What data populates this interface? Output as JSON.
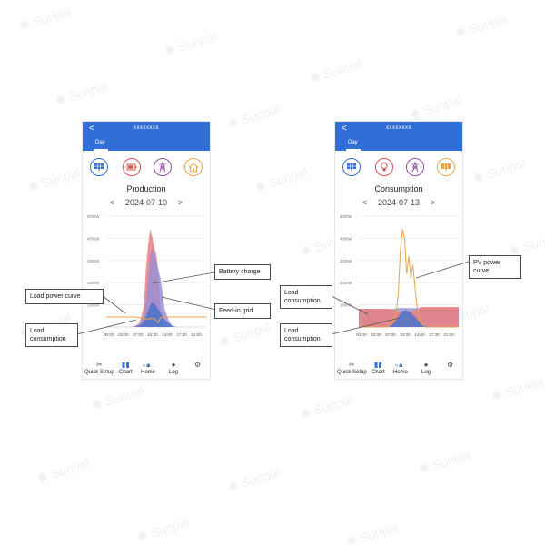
{
  "watermark": "Sunpal",
  "phones": {
    "left": {
      "header_title": "xxxxxxxx",
      "back_glyph": "<",
      "tabs": [
        "Day",
        "",
        ""
      ],
      "page_title": "Production",
      "date": "2024-07-10",
      "prev_glyph": "<",
      "next_glyph": ">",
      "icons": [
        "solar-panel-icon",
        "battery-icon",
        "grid-tower-icon",
        "home-icon"
      ],
      "nav": [
        "Quick Setup",
        "Chart",
        "Home",
        "Log",
        ""
      ],
      "chart_data": {
        "type": "area",
        "y_ticks": [
          "5000W",
          "4000W",
          "3000W",
          "2000W",
          "1000W"
        ],
        "x_ticks": [
          "00:00",
          "03:30",
          "07:00",
          "10:30",
          "14:00",
          "17:30",
          "21:00"
        ],
        "xlim": [
          0,
          24
        ],
        "ylim": [
          0,
          5000
        ],
        "x": [
          0,
          1,
          2,
          3,
          4,
          5,
          6,
          7,
          8,
          9,
          9.5,
          10,
          10.5,
          11,
          11.5,
          12,
          12.5,
          13,
          13.5,
          14,
          15,
          16,
          17,
          18,
          19,
          20,
          21,
          22,
          23,
          24
        ],
        "series": [
          {
            "name": "Battery charge",
            "color": "#e8807f",
            "values": [
              0,
              0,
              0,
              0,
              0,
              0,
              0,
              60,
              200,
              900,
              2600,
              3600,
              4400,
              4100,
              3600,
              3300,
              2400,
              900,
              200,
              100,
              0,
              0,
              0,
              0,
              0,
              0,
              0,
              0,
              0,
              0
            ]
          },
          {
            "name": "Feed-in grid",
            "color": "#9b8fd4",
            "values": [
              0,
              0,
              0,
              0,
              0,
              0,
              0,
              40,
              150,
              500,
              1200,
              2200,
              3200,
              3600,
              3400,
              3000,
              2600,
              2200,
              1600,
              800,
              300,
              0,
              0,
              0,
              0,
              0,
              0,
              0,
              0,
              0
            ]
          },
          {
            "name": "Load consumption",
            "color": "#4a73cc",
            "values": [
              0,
              0,
              0,
              0,
              0,
              0,
              0,
              0,
              60,
              250,
              450,
              700,
              950,
              1100,
              1050,
              950,
              800,
              650,
              500,
              350,
              150,
              40,
              0,
              0,
              0,
              0,
              0,
              0,
              0,
              0
            ]
          },
          {
            "name": "Load power curve",
            "color": "#e8a54b",
            "values": [
              450,
              450,
              450,
              450,
              450,
              450,
              450,
              450,
              420,
              380,
              360,
              380,
              360,
              400,
              380,
              300,
              200,
              420,
              430,
              450,
              450,
              450,
              450,
              450,
              450,
              450,
              450,
              450,
              450,
              450
            ]
          }
        ]
      },
      "callouts": [
        "Load power curve",
        "Load consumption",
        "Battery charge",
        "Feed-in grid"
      ]
    },
    "right": {
      "header_title": "xxxxxxxx",
      "back_glyph": "<",
      "tabs": [
        "Day",
        "",
        ""
      ],
      "page_title": "Consumption",
      "date": "2024-07-13",
      "prev_glyph": "<",
      "next_glyph": ">",
      "icons": [
        "solar-panel-icon",
        "bulb-icon",
        "grid-tower-icon",
        "battery-icon"
      ],
      "nav": [
        "Quick Setup",
        "Chart",
        "Home",
        "Log",
        ""
      ],
      "chart_data": {
        "type": "area",
        "y_ticks": [
          "5000W",
          "4000W",
          "3000W",
          "2000W",
          "1000W"
        ],
        "x_ticks": [
          "00:00",
          "03:30",
          "07:00",
          "10:30",
          "14:00",
          "17:30",
          "21:00"
        ],
        "xlim": [
          0,
          24
        ],
        "ylim": [
          0,
          5000
        ],
        "x": [
          0,
          1,
          2,
          3,
          4,
          5,
          6,
          7,
          8,
          9,
          9.5,
          10,
          10.5,
          11,
          11.5,
          12,
          12.5,
          13,
          13.5,
          14,
          15,
          16,
          17,
          18,
          19,
          20,
          21,
          22,
          23,
          24
        ],
        "series": [
          {
            "name": "Load consumption",
            "color": "#9b8fd4",
            "values": [
              800,
              800,
              800,
              800,
              800,
              800,
              800,
              800,
              800,
              850,
              850,
              850,
              850,
              850,
              850,
              850,
              850,
              850,
              850,
              850,
              850,
              850,
              850,
              850,
              850,
              850,
              850,
              850,
              850,
              850
            ]
          },
          {
            "name": "Load consumption",
            "color": "#e8807f",
            "values": [
              820,
              820,
              820,
              820,
              820,
              820,
              820,
              820,
              800,
              750,
              700,
              650,
              700,
              700,
              700,
              700,
              700,
              700,
              750,
              800,
              900,
              900,
              900,
              900,
              900,
              900,
              900,
              900,
              900,
              900
            ]
          },
          {
            "name": "Load consumption",
            "color": "#4a73cc",
            "values": [
              0,
              0,
              0,
              0,
              0,
              0,
              0,
              0,
              100,
              300,
              450,
              600,
              700,
              750,
              750,
              700,
              650,
              550,
              450,
              350,
              150,
              50,
              0,
              0,
              0,
              0,
              0,
              0,
              0,
              0
            ]
          },
          {
            "name": "PV power curve",
            "color": "#e8a54b",
            "values": [
              0,
              0,
              0,
              0,
              0,
              0,
              0,
              0,
              200,
              700,
              1500,
              3500,
              4400,
              4000,
              2400,
              3200,
              2200,
              2800,
              1800,
              900,
              150,
              0,
              0,
              0,
              0,
              0,
              0,
              0,
              0,
              0
            ]
          }
        ]
      },
      "callouts": [
        "PV power curve",
        "Load consumption",
        "Load consumption"
      ]
    }
  }
}
